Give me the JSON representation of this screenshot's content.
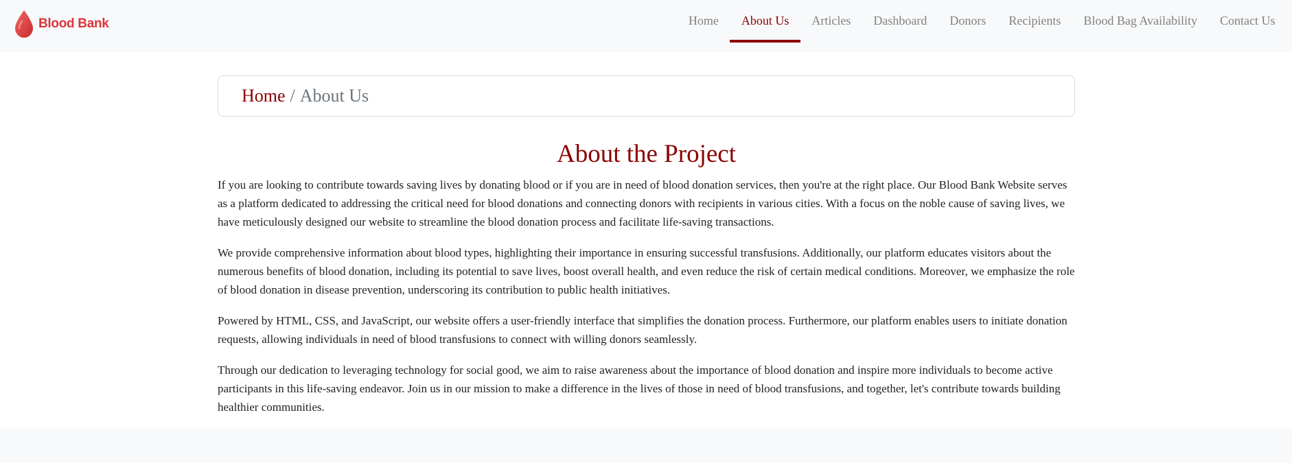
{
  "brand": {
    "name": "Blood Bank",
    "icon": "blood-drop-icon",
    "color": "#d9363e"
  },
  "nav": {
    "active_color": "#8b0000",
    "items": [
      {
        "label": "Home"
      },
      {
        "label": "About Us",
        "active": true
      },
      {
        "label": "Articles"
      },
      {
        "label": "Dashboard"
      },
      {
        "label": "Donors"
      },
      {
        "label": "Recipients"
      },
      {
        "label": "Blood Bag Availability"
      },
      {
        "label": "Contact Us"
      }
    ]
  },
  "breadcrumb": {
    "home": "Home",
    "separator": "/",
    "current": "About Us"
  },
  "main": {
    "title": "About the Project",
    "paragraphs": [
      "If you are looking to contribute towards saving lives by donating blood or if you are in need of blood donation services, then you're at the right place. Our Blood Bank Website serves as a platform dedicated to addressing the critical need for blood donations and connecting donors with recipients in various cities. With a focus on the noble cause of saving lives, we have meticulously designed our website to streamline the blood donation process and facilitate life-saving transactions.",
      "We provide comprehensive information about blood types, highlighting their importance in ensuring successful transfusions. Additionally, our platform educates visitors about the numerous benefits of blood donation, including its potential to save lives, boost overall health, and even reduce the risk of certain medical conditions. Moreover, we emphasize the role of blood donation in disease prevention, underscoring its contribution to public health initiatives.",
      "Powered by HTML, CSS, and JavaScript, our website offers a user-friendly interface that simplifies the donation process. Furthermore, our platform enables users to initiate donation requests, allowing individuals in need of blood transfusions to connect with willing donors seamlessly.",
      "Through our dedication to leveraging technology for social good, we aim to raise awareness about the importance of blood donation and inspire more individuals to become active participants in this life-saving endeavor. Join us in our mission to make a difference in the lives of those in need of blood transfusions, and together, let's contribute towards building healthier communities."
    ]
  }
}
